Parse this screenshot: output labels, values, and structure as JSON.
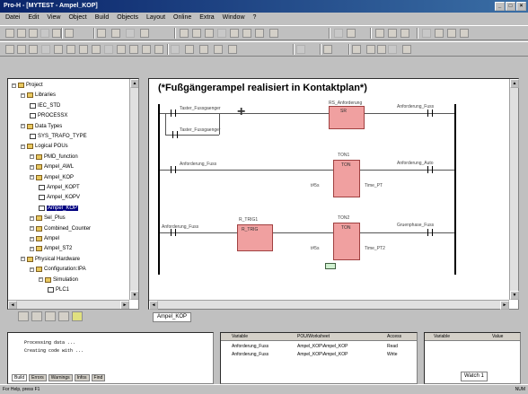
{
  "window": {
    "title": "Pro-H - [MYTEST - Ampel_KOP]"
  },
  "menu": [
    "Datei",
    "Edit",
    "View",
    "Object",
    "Build",
    "Objects",
    "Layout",
    "Online",
    "Extra",
    "Window",
    "?"
  ],
  "tree": {
    "items": [
      {
        "label": "Project",
        "level": 0,
        "type": "folder"
      },
      {
        "label": "Libraries",
        "level": 1,
        "type": "folder"
      },
      {
        "label": "IEC_STD",
        "level": 2,
        "type": "doc"
      },
      {
        "label": "PROCESSX",
        "level": 2,
        "type": "doc"
      },
      {
        "label": "Data Types",
        "level": 1,
        "type": "folder"
      },
      {
        "label": "SYS_TRAFO_TYPE",
        "level": 2,
        "type": "doc"
      },
      {
        "label": "Logical POUs",
        "level": 1,
        "type": "folder"
      },
      {
        "label": "PMD_function",
        "level": 2,
        "type": "folder"
      },
      {
        "label": "Ampel_AWL",
        "level": 2,
        "type": "folder"
      },
      {
        "label": "Ampel_KOP",
        "level": 2,
        "type": "folder"
      },
      {
        "label": "Ampel_KOPT",
        "level": 3,
        "type": "doc"
      },
      {
        "label": "Ampel_KOPV",
        "level": 3,
        "type": "doc"
      },
      {
        "label": "Ampel_KOP",
        "level": 3,
        "type": "doc",
        "selected": true
      },
      {
        "label": "Sel_Plus",
        "level": 2,
        "type": "folder"
      },
      {
        "label": "Combined_Counter",
        "level": 2,
        "type": "folder"
      },
      {
        "label": "Ampel",
        "level": 2,
        "type": "folder"
      },
      {
        "label": "Ampel_ST2",
        "level": 2,
        "type": "folder"
      },
      {
        "label": "Physical Hardware",
        "level": 1,
        "type": "folder"
      },
      {
        "label": "Configuration:IPA",
        "level": 2,
        "type": "folder"
      },
      {
        "label": "Simulation",
        "level": 3,
        "type": "folder"
      },
      {
        "label": "PLC1",
        "level": 4,
        "type": "doc"
      }
    ]
  },
  "editor": {
    "heading": "(*Fußgängerampel realisiert in Kontaktplan*)",
    "tab": "Ampel_KOP",
    "rung1": {
      "in1": "Taster_Fussgaenger",
      "in2": "Taster_Fussgaenger",
      "block": "SR",
      "block_name": "RS_Anforderung",
      "out": "Anforderung_Fuss"
    },
    "rung2": {
      "in": "Anforderung_Fuss",
      "block": "TON",
      "block_name": "TON1",
      "pt": "t#5s",
      "q": "Anforderung_Auto",
      "et": "Time_PT"
    },
    "rung3": {
      "in": "Anforderung_Fuss",
      "block1": "R_TRIG",
      "block1_name": "R_TRIG1",
      "block2": "TON",
      "block2_name": "TON2",
      "pt": "t#5s",
      "q": "Gruenphase_Fuss",
      "et": "Time_PT2"
    }
  },
  "output": {
    "lines": [
      "Processing data ...",
      "Creating code with ..."
    ],
    "tabs": [
      "Build",
      "Errors",
      "Warnings",
      "Infos",
      "Find"
    ]
  },
  "xref": {
    "headers": [
      "Variable",
      "POU/Worksheet",
      "Access"
    ],
    "rows": [
      [
        "Anforderung_Fuss",
        "Ampel_KOP\\Ampel_KOP",
        "Read"
      ],
      [
        "Anforderung_Fuss",
        "Ampel_KOP\\Ampel_KOP",
        "Write"
      ]
    ]
  },
  "watch": {
    "headers": [
      "Variable",
      "Value"
    ],
    "tab": "Watch 1"
  },
  "status": {
    "left": "For Help, press F1",
    "right": "NUM"
  }
}
